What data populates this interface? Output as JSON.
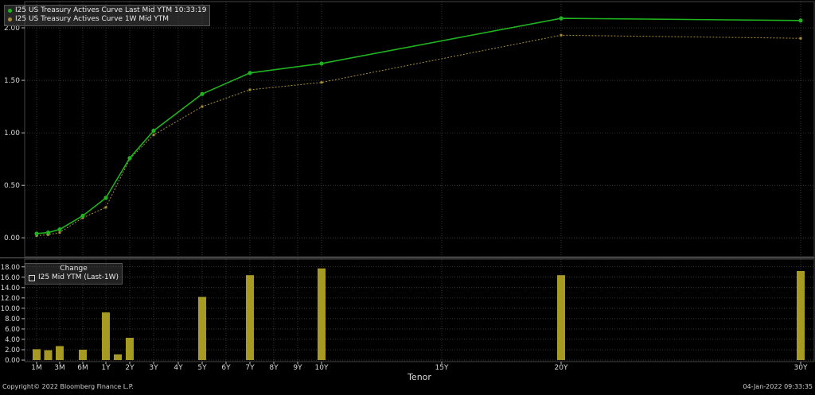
{
  "colors": {
    "current": "#1fb31f",
    "prior": "#a98f3a",
    "bar": "#a69a22",
    "grid": "#5a5a5a",
    "axis_text": "#d8d8d8"
  },
  "legend": {
    "current_label": "I25 US Treasury Actives Curve Last Mid YTM 10:33:19",
    "prior_label": "I25 US Treasury Actives Curve 1W Mid YTM"
  },
  "legend2": {
    "title": "Change",
    "label": "I25 Mid YTM (Last-1W)"
  },
  "footer": {
    "copyright": "Copyright© 2022 Bloomberg Finance L.P.",
    "timestamp": "04-Jan-2022 09:33:35"
  },
  "chart_data": [
    {
      "type": "line",
      "xlabel": "Tenor",
      "ylim": [
        -0.18,
        2.25
      ],
      "y_ticks": [
        "2.00",
        "1.50",
        "1.00",
        "0.50",
        "0.00"
      ],
      "x_tenor_years": [
        0.0833,
        0.25,
        0.5,
        1,
        2,
        3,
        5,
        7,
        10,
        20,
        30
      ],
      "series": [
        {
          "name": "I25 US Treasury Actives Curve Last Mid YTM 10:33:19",
          "values": [
            0.04,
            0.05,
            0.08,
            0.21,
            0.38,
            0.76,
            1.02,
            1.37,
            1.57,
            1.66,
            2.09,
            2.07
          ]
        },
        {
          "name": "I25 US Treasury Actives Curve 1W Mid YTM",
          "values": [
            0.02,
            0.03,
            0.05,
            0.19,
            0.29,
            0.75,
            0.98,
            1.25,
            1.41,
            1.48,
            1.93,
            1.9
          ]
        }
      ],
      "points_x_years": [
        0.0833,
        0.1667,
        0.25,
        0.5,
        1,
        2,
        3,
        5,
        7,
        10,
        20,
        30
      ]
    },
    {
      "type": "bar",
      "ylim": [
        -0.3,
        19.5
      ],
      "y_ticks": [
        "18.00",
        "16.00",
        "14.00",
        "12.00",
        "10.00",
        "8.00",
        "6.00",
        "4.00",
        "2.00",
        "0.00"
      ],
      "x_years": [
        0.0833,
        0.1667,
        0.25,
        0.5,
        1,
        1.5,
        2,
        5,
        7,
        10,
        20,
        30
      ],
      "values": [
        2.1,
        1.9,
        2.7,
        2.0,
        9.2,
        1.1,
        4.3,
        12.2,
        16.4,
        17.7,
        16.4,
        17.2
      ],
      "x_tick_labels": [
        "1M",
        "3M",
        "6M",
        "1Y",
        "2Y",
        "3Y",
        "4Y",
        "5Y",
        "6Y",
        "7Y",
        "8Y",
        "9Y",
        "10Y",
        "15Y",
        "20Y",
        "30Y"
      ],
      "x_tick_years": [
        0.0833,
        0.25,
        0.5,
        1,
        2,
        3,
        4,
        5,
        6,
        7,
        8,
        9,
        10,
        15,
        20,
        30
      ]
    }
  ]
}
